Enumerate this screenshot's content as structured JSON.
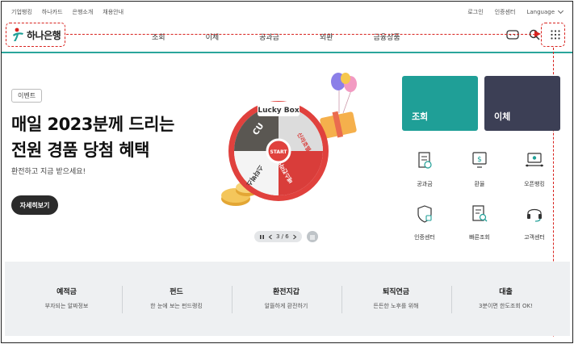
{
  "util": {
    "left_links": [
      "기업뱅킹",
      "하나카드",
      "은행소개",
      "채용안내"
    ],
    "login": "로그인",
    "cert": "인증센터",
    "language": "Language"
  },
  "header": {
    "logo": "하나은행",
    "menu": [
      "조회",
      "이체",
      "공과금",
      "외환",
      "금융상품"
    ]
  },
  "hero": {
    "badge": "이벤트",
    "title_line1": "매일 2023분께 드리는",
    "title_line2": "전원 경품 당첨 혜택",
    "subtitle": "환전하고 지금 받으세요!",
    "button": "자세히보기",
    "wheel": {
      "title": "Lucky Box",
      "center": "START",
      "segments": [
        "CU",
        "신라호텔",
        "배스킨라빈스",
        "스타벅스"
      ]
    },
    "pager": "3 / 6"
  },
  "tiles": {
    "inquiry": "조회",
    "transfer": "이체"
  },
  "quick_menu": [
    "공과금",
    "환율",
    "오픈뱅킹",
    "인증센터",
    "빠른조회",
    "고객센터"
  ],
  "bottom": [
    {
      "title": "예적금",
      "sub": "부자되는 알짜정보"
    },
    {
      "title": "펀드",
      "sub": "한 눈에 보는 펀드랭킹"
    },
    {
      "title": "환전지갑",
      "sub": "알뜰하게 환전하기"
    },
    {
      "title": "퇴직연금",
      "sub": "든든한 노후를 위해"
    },
    {
      "title": "대출",
      "sub": "3분이면 한도조회 OK!"
    }
  ],
  "colors": {
    "brand_teal": "#1f9f97",
    "tile_dark": "#3c3f55",
    "annotation_red": "#d8231f"
  }
}
